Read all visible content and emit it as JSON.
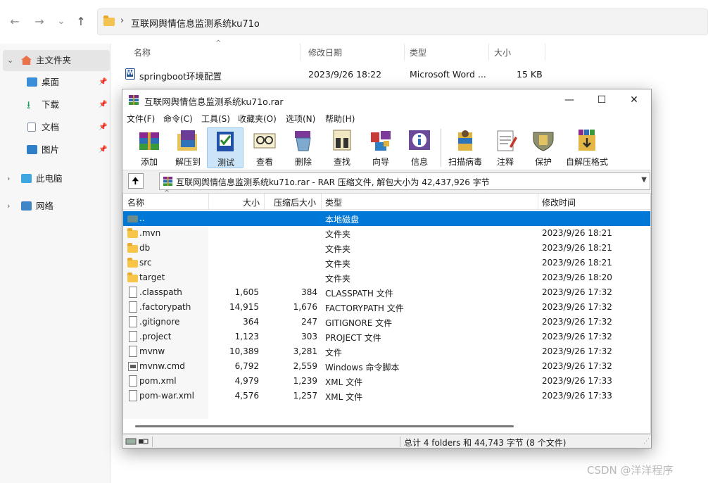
{
  "explorer": {
    "nav": {
      "back_icon": "←",
      "forward_icon": "→",
      "recent_icon": "⌄",
      "up_icon": "↑"
    },
    "address": {
      "separator": "›",
      "path": "互联网舆情信息监测系统ku71o"
    },
    "sidebar": [
      {
        "label": "主文件夹",
        "icon": "home-icon",
        "expand": "⌄",
        "selected": true
      },
      {
        "label": "桌面",
        "icon": "desktop-icon",
        "pinned": true
      },
      {
        "label": "下载",
        "icon": "download-icon",
        "pinned": true
      },
      {
        "label": "文档",
        "icon": "documents-icon",
        "pinned": true
      },
      {
        "label": "图片",
        "icon": "pictures-icon",
        "pinned": true
      },
      {
        "label": "此电脑",
        "icon": "computer-icon",
        "expand": "›"
      },
      {
        "label": "网络",
        "icon": "network-icon",
        "expand": "›"
      }
    ],
    "columns": {
      "name": "名称",
      "modified": "修改日期",
      "type": "类型",
      "size": "大小",
      "sort_glyph": "^"
    },
    "file": {
      "name": "springboot环境配置",
      "modified": "2023/9/26 18:22",
      "type": "Microsoft Word ...",
      "size": "15 KB"
    }
  },
  "winrar": {
    "title": "互联网舆情信息监测系统ku71o.rar",
    "window_buttons": {
      "minimize": "—",
      "maximize": "☐",
      "close": "✕"
    },
    "menu": [
      "文件(F)",
      "命令(C)",
      "工具(S)",
      "收藏夹(O)",
      "选项(N)",
      "帮助(H)"
    ],
    "toolbar": [
      {
        "label": "添加",
        "icon": "add-icon"
      },
      {
        "label": "解压到",
        "icon": "extract-icon"
      },
      {
        "label": "测试",
        "icon": "test-icon",
        "selected": true
      },
      {
        "label": "查看",
        "icon": "view-icon"
      },
      {
        "label": "删除",
        "icon": "delete-icon"
      },
      {
        "label": "查找",
        "icon": "find-icon"
      },
      {
        "label": "向导",
        "icon": "wizard-icon"
      },
      {
        "label": "信息",
        "icon": "info-icon"
      },
      {
        "label": "扫描病毒",
        "icon": "virus-scan-icon"
      },
      {
        "label": "注释",
        "icon": "comment-icon"
      },
      {
        "label": "保护",
        "icon": "protect-icon"
      },
      {
        "label": "自解压格式",
        "icon": "sfx-icon"
      }
    ],
    "path_text": "互联网舆情信息监测系统ku71o.rar - RAR 压缩文件, 解包大小为 42,437,926 字节",
    "columns": {
      "name": "名称",
      "size": "大小",
      "packed": "压缩后大小",
      "type": "类型",
      "modified": "修改时间",
      "sort_glyph": "^"
    },
    "rows": [
      {
        "name": "..",
        "size": "",
        "packed": "",
        "type": "本地磁盘",
        "modified": "",
        "icon": "drive",
        "selected": true
      },
      {
        "name": ".mvn",
        "size": "",
        "packed": "",
        "type": "文件夹",
        "modified": "2023/9/26 18:21",
        "icon": "folder"
      },
      {
        "name": "db",
        "size": "",
        "packed": "",
        "type": "文件夹",
        "modified": "2023/9/26 18:21",
        "icon": "folder"
      },
      {
        "name": "src",
        "size": "",
        "packed": "",
        "type": "文件夹",
        "modified": "2023/9/26 18:21",
        "icon": "folder"
      },
      {
        "name": "target",
        "size": "",
        "packed": "",
        "type": "文件夹",
        "modified": "2023/9/26 18:20",
        "icon": "folder"
      },
      {
        "name": ".classpath",
        "size": "1,605",
        "packed": "384",
        "type": "CLASSPATH 文件",
        "modified": "2023/9/26 17:32",
        "icon": "file"
      },
      {
        "name": ".factorypath",
        "size": "14,915",
        "packed": "1,676",
        "type": "FACTORYPATH 文件",
        "modified": "2023/9/26 17:32",
        "icon": "file"
      },
      {
        "name": ".gitignore",
        "size": "364",
        "packed": "247",
        "type": "GITIGNORE 文件",
        "modified": "2023/9/26 17:32",
        "icon": "file"
      },
      {
        "name": ".project",
        "size": "1,123",
        "packed": "303",
        "type": "PROJECT 文件",
        "modified": "2023/9/26 17:32",
        "icon": "file"
      },
      {
        "name": "mvnw",
        "size": "10,389",
        "packed": "3,281",
        "type": "文件",
        "modified": "2023/9/26 17:32",
        "icon": "file"
      },
      {
        "name": "mvnw.cmd",
        "size": "6,792",
        "packed": "2,559",
        "type": "Windows 命令脚本",
        "modified": "2023/9/26 17:32",
        "icon": "cmd"
      },
      {
        "name": "pom.xml",
        "size": "4,979",
        "packed": "1,239",
        "type": "XML 文件",
        "modified": "2023/9/26 17:33",
        "icon": "file"
      },
      {
        "name": "pom-war.xml",
        "size": "4,576",
        "packed": "1,257",
        "type": "XML 文件",
        "modified": "2023/9/26 17:33",
        "icon": "file"
      }
    ],
    "status": "总计 4 folders 和 44,743 字节 (8 个文件)"
  },
  "watermark": "CSDN @洋洋程序"
}
